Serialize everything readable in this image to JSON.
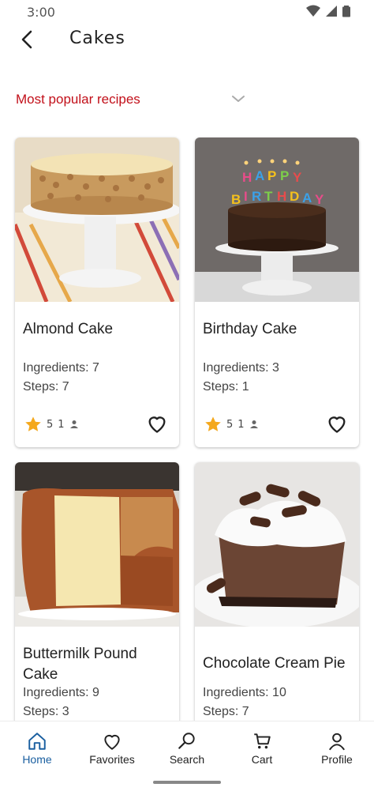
{
  "status": {
    "time": "3:00"
  },
  "header": {
    "title": "Cakes"
  },
  "filter": {
    "label": "Most popular recipes"
  },
  "recipes": [
    {
      "name": "Almond Cake",
      "ingredients": "Ingredients: 7",
      "steps": "Steps: 7",
      "rating": "5",
      "users": "1"
    },
    {
      "name": "Birthday Cake",
      "ingredients": "Ingredients: 3",
      "steps": "Steps: 1",
      "rating": "5",
      "users": "1"
    },
    {
      "name": "Buttermilk Pound Cake",
      "ingredients": "Ingredients: 9",
      "steps": "Steps: 3"
    },
    {
      "name": "Chocolate Cream Pie",
      "ingredients": "Ingredients: 10",
      "steps": "Steps: 7"
    }
  ],
  "nav": [
    {
      "label": "Home",
      "icon": "home-icon",
      "active": true
    },
    {
      "label": "Favorites",
      "icon": "heart-icon"
    },
    {
      "label": "Search",
      "icon": "search-icon"
    },
    {
      "label": "Cart",
      "icon": "cart-icon"
    },
    {
      "label": "Profile",
      "icon": "person-icon"
    }
  ],
  "colors": {
    "accent": "#c2101a",
    "nav_active": "#1a5fa0",
    "star": "#f4a81d"
  }
}
